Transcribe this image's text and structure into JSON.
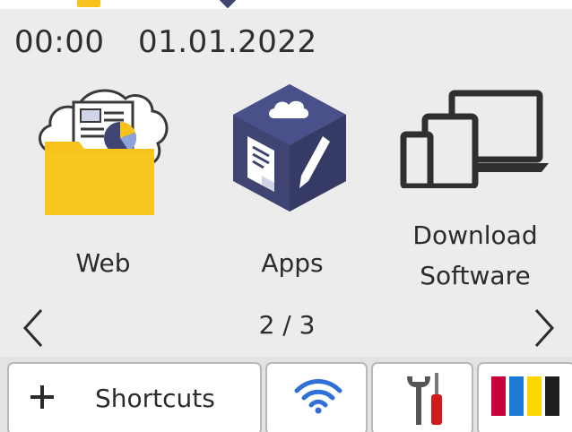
{
  "status": {
    "time": "00:00",
    "date": "01.01.2022"
  },
  "apps": [
    {
      "label": "Web",
      "icon": "web-folder-cloud-icon"
    },
    {
      "label": "Apps",
      "icon": "apps-cube-icon"
    },
    {
      "label_line1": "Download",
      "label_line2": "Software",
      "icon": "devices-icon"
    }
  ],
  "pager": {
    "indicator": "2 / 3",
    "prev_icon": "chevron-left-icon",
    "next_icon": "chevron-right-icon"
  },
  "bottom_bar": {
    "shortcuts_label": "Shortcuts",
    "shortcuts_icon": "plus-icon",
    "wifi_icon": "wifi-icon",
    "settings_icon": "wrench-screwdriver-icon",
    "ink_icon": "ink-levels-icon"
  },
  "colors": {
    "panel_background": "#ececec",
    "folder_yellow": "#f6c21b",
    "cube_navy": "#3f4472",
    "wifi_blue": "#2f6fd6",
    "ink_cyan": "#1d7bd8",
    "ink_magenta": "#c8003c",
    "ink_yellow": "#ffd800",
    "ink_black": "#1e1e1e"
  }
}
